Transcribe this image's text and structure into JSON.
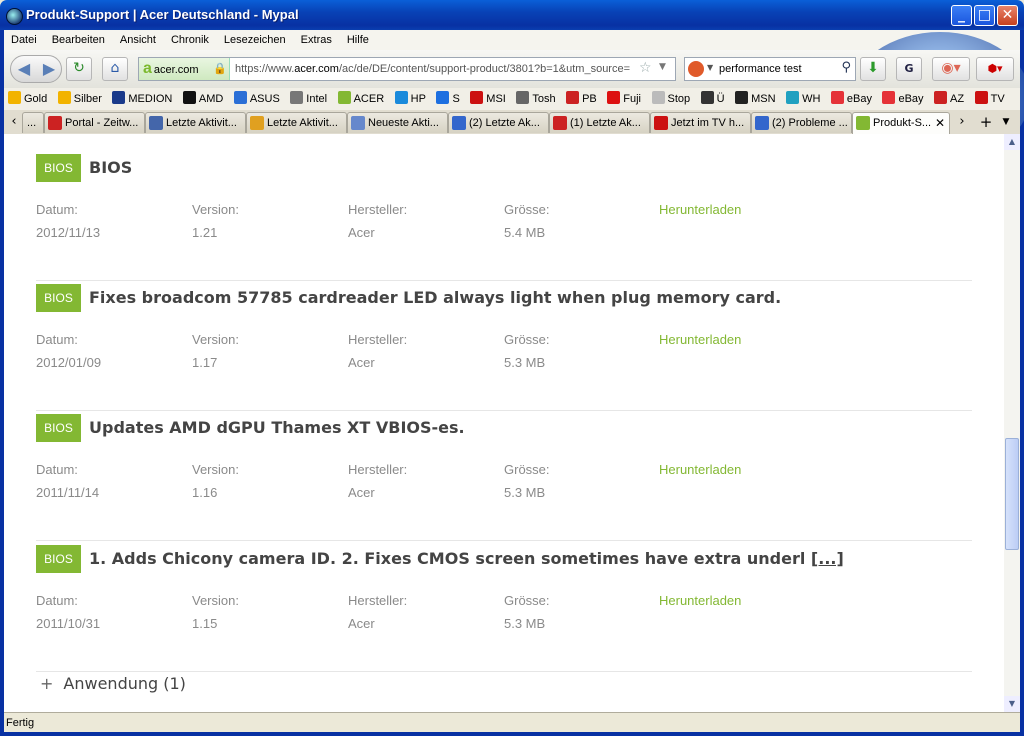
{
  "window": {
    "title": "Produkt-Support | Acer Deutschland - Mypal",
    "controls": {
      "minimize": "_",
      "maximize": "□",
      "close": "✕"
    }
  },
  "menu": [
    "Datei",
    "Bearbeiten",
    "Ansicht",
    "Chronik",
    "Lesezeichen",
    "Extras",
    "Hilfe"
  ],
  "nav": {
    "identity_label": "acer.com",
    "url_prefix": "https://www.",
    "url_domain": "acer.com",
    "url_rest": "/ac/de/DE/content/support-product/3801?b=1&utm_source=",
    "search_text": "performance test"
  },
  "bookmarks": [
    {
      "label": "Gold",
      "color": "#f2b300"
    },
    {
      "label": "Silber",
      "color": "#f2b300"
    },
    {
      "label": "MEDION",
      "color": "#1a3a8a"
    },
    {
      "label": "AMD",
      "color": "#111111"
    },
    {
      "label": "ASUS",
      "color": "#2b6fd6"
    },
    {
      "label": "Intel",
      "color": "#777777"
    },
    {
      "label": "ACER",
      "color": "#83b833"
    },
    {
      "label": "HP",
      "color": "#1a8adb"
    },
    {
      "label": "S",
      "color": "#1d6fe0"
    },
    {
      "label": "MSI",
      "color": "#cc1111"
    },
    {
      "label": "Tosh",
      "color": "#666666"
    },
    {
      "label": "PB",
      "color": "#cc2222"
    },
    {
      "label": "Fuji",
      "color": "#dd1111"
    },
    {
      "label": "Stop",
      "color": "#bbbbbb"
    },
    {
      "label": "Ü",
      "color": "#333333"
    },
    {
      "label": "MSN",
      "color": "#222222"
    },
    {
      "label": "WH",
      "color": "#20a0c0"
    },
    {
      "label": "eBay",
      "color": "#e53238"
    },
    {
      "label": "eBay",
      "color": "#e53238"
    },
    {
      "label": "AZ",
      "color": "#cc2222"
    },
    {
      "label": "TV",
      "color": "#cc1111"
    }
  ],
  "tabs": [
    {
      "label": "...",
      "color": "#999999"
    },
    {
      "label": "Portal - Zeitw...",
      "color": "#cc2222"
    },
    {
      "label": "Letzte Aktivit...",
      "color": "#4466aa"
    },
    {
      "label": "Letzte Aktivit...",
      "color": "#e0a020"
    },
    {
      "label": "Neueste Akti...",
      "color": "#6688cc"
    },
    {
      "label": "(2) Letzte Ak...",
      "color": "#3366cc"
    },
    {
      "label": "(1) Letzte Ak...",
      "color": "#cc2222"
    },
    {
      "label": "Jetzt im TV h...",
      "color": "#cc1111"
    },
    {
      "label": "(2) Probleme ...",
      "color": "#3366cc"
    },
    {
      "label": "Produkt-S...",
      "color": "#83b833"
    }
  ],
  "labels": {
    "date": "Datum:",
    "version": "Version:",
    "manufacturer": "Hersteller:",
    "size": "Grösse:",
    "download": "Herunterladen"
  },
  "entries": [
    {
      "badge": "BIOS",
      "title": "BIOS",
      "date": "2012/11/13",
      "version": "1.21",
      "manufacturer": "Acer",
      "size": "5.4 MB",
      "more": ""
    },
    {
      "badge": "BIOS",
      "title": "Fixes broadcom 57785 cardreader LED always light when plug memory card.",
      "date": "2012/01/09",
      "version": "1.17",
      "manufacturer": "Acer",
      "size": "5.3 MB",
      "more": ""
    },
    {
      "badge": "BIOS",
      "title": "Updates AMD dGPU Thames XT VBIOS-es.",
      "date": "2011/11/14",
      "version": "1.16",
      "manufacturer": "Acer",
      "size": "5.3 MB",
      "more": ""
    },
    {
      "badge": "BIOS",
      "title": "1. Adds Chicony camera ID. 2. Fixes CMOS screen sometimes have extra underl ",
      "date": "2011/10/31",
      "version": "1.15",
      "manufacturer": "Acer",
      "size": "5.3 MB",
      "more": "[...]"
    }
  ],
  "section": {
    "plus": "+",
    "label": "Anwendung (1)"
  },
  "status": "Fertig"
}
